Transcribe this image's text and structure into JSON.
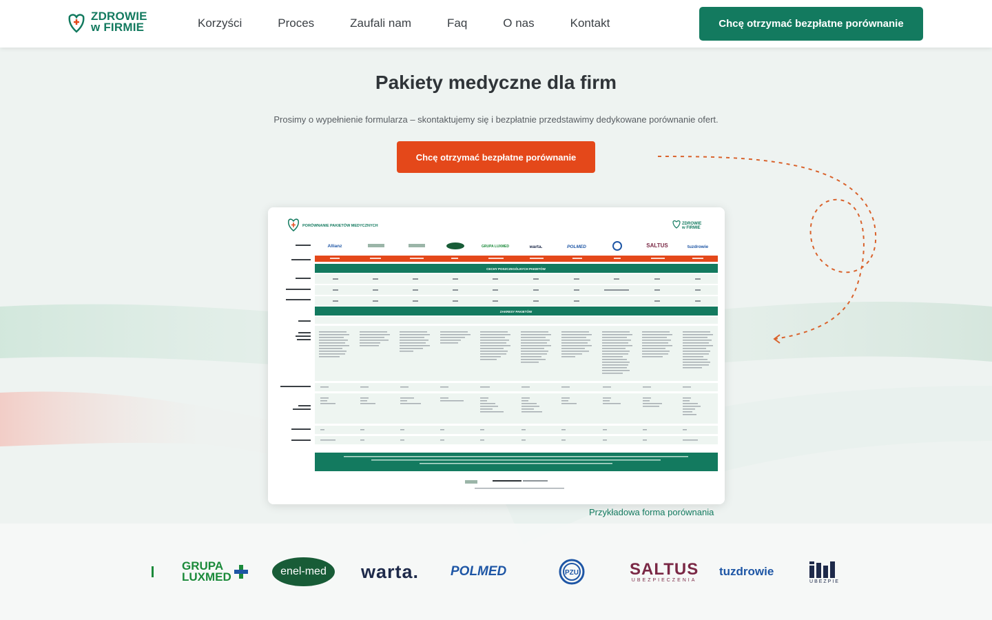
{
  "header": {
    "logo_line1": "ZDROWIE",
    "logo_line2": "w FIRMIE",
    "nav": [
      "Korzyści",
      "Proces",
      "Zaufali nam",
      "Faq",
      "O nas",
      "Kontakt"
    ],
    "cta_label": "Chcę otrzymać bezpłatne porównanie"
  },
  "hero": {
    "title": "Pakiety medyczne dla firm",
    "subtitle": "Prosimy o wypełnienie formularza – skontaktujemy się i bezpłatnie przedstawimy dedykowane porównanie ofert.",
    "cta_label": "Chcę otrzymać bezpłatne porównanie"
  },
  "comparison_preview": {
    "doc_title": "PORÓWNANIE PAKIETÓW MEDYCZNYCH",
    "doc_logo_line1": "ZDROWIE",
    "doc_logo_line2": "w FIRMIE",
    "insurers": [
      "Allianz",
      "",
      "",
      "enel-med",
      "GRUPA LUXMED",
      "warta.",
      "POLMED",
      "",
      "SALTUS",
      "tuzdrowie"
    ],
    "section_1": "CECHY POSZCZEGÓLNYCH PAKIETÓW",
    "section_2": "ZAKRESY PAKIETÓW",
    "caption": "Przykładowa forma porównania"
  },
  "partners": {
    "grupa_luxmed_l1": "GRUPA",
    "grupa_luxmed_l2": "LUXMED",
    "enelmed": "enel-med",
    "warta": "warta.",
    "polmed": "POLMED",
    "pzu": "PZU",
    "saltus_l1": "SALTUS",
    "saltus_l2": "UBEZPIECZENIA",
    "tuzdrowie": "tuzdrowie",
    "interrisk_l2": "UBEZPIE"
  },
  "colors": {
    "brand_green": "#137a5f",
    "cta_orange": "#e4481a",
    "background": "#eef3f1"
  }
}
